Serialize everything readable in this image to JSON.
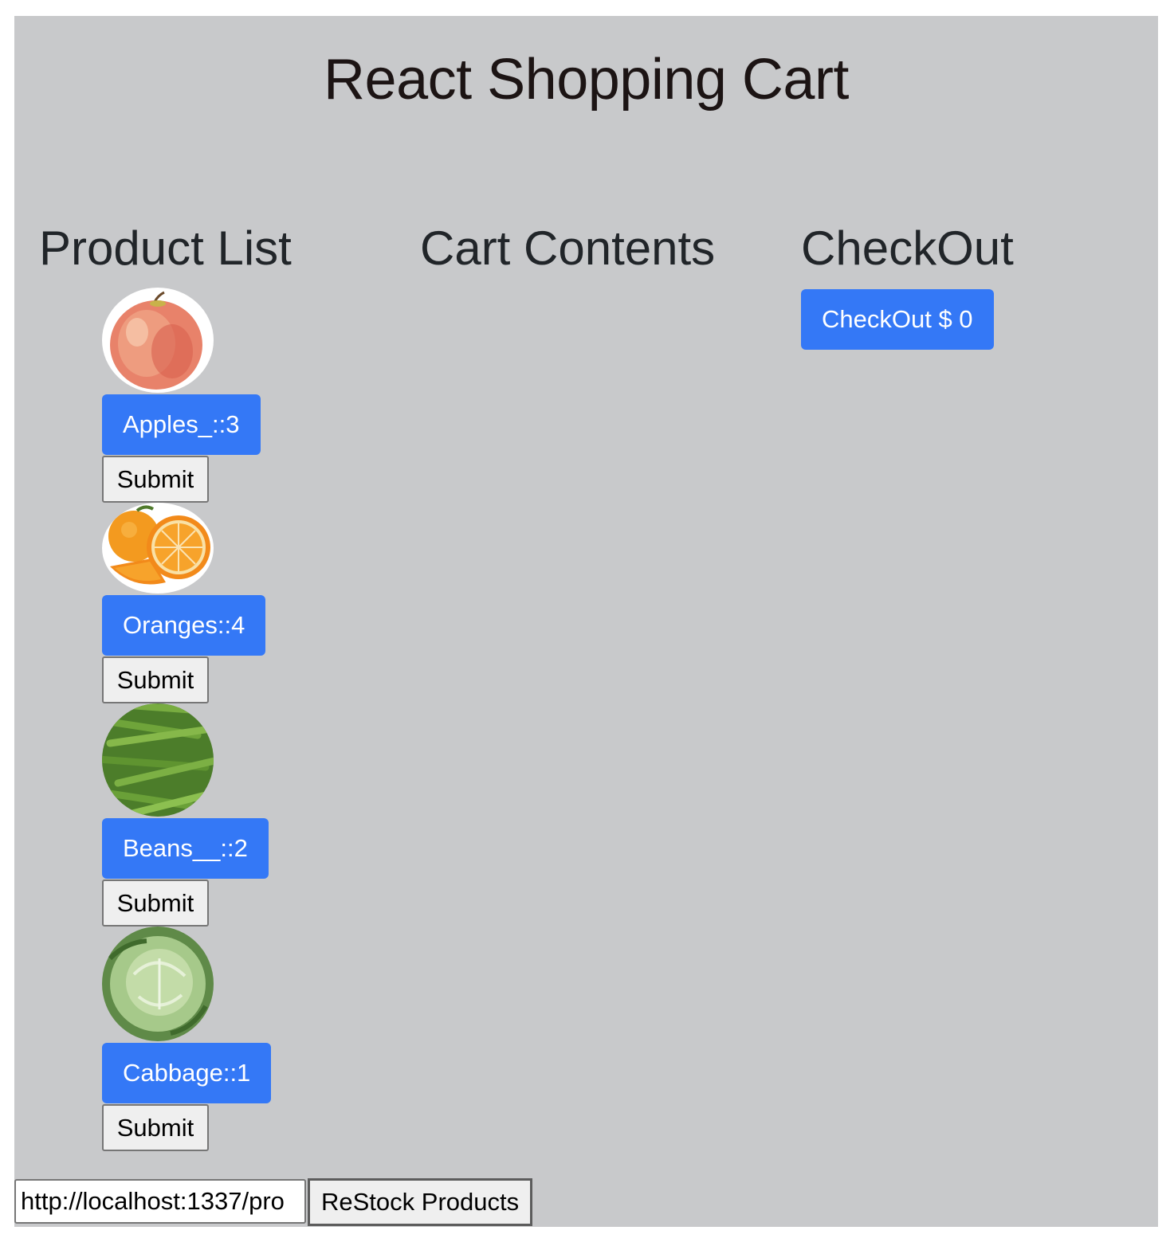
{
  "header": {
    "title": "React Shopping Cart"
  },
  "columns": {
    "products_heading": "Product List",
    "cart_heading": "Cart Contents",
    "checkout_heading": "CheckOut"
  },
  "products": [
    {
      "label": "Apples_::3",
      "submit_label": "Submit",
      "image": "apple-image"
    },
    {
      "label": "Oranges::4",
      "submit_label": "Submit",
      "image": "orange-image"
    },
    {
      "label": "Beans__::2",
      "submit_label": "Submit",
      "image": "beans-image"
    },
    {
      "label": "Cabbage::1",
      "submit_label": "Submit",
      "image": "cabbage-image"
    }
  ],
  "checkout": {
    "button_label": "CheckOut $ 0"
  },
  "restock": {
    "url_value": "http://localhost:1337/pro",
    "button_label": "ReStock Products"
  },
  "colors": {
    "page_bg": "#c8c9cb",
    "primary": "#3478f6"
  }
}
